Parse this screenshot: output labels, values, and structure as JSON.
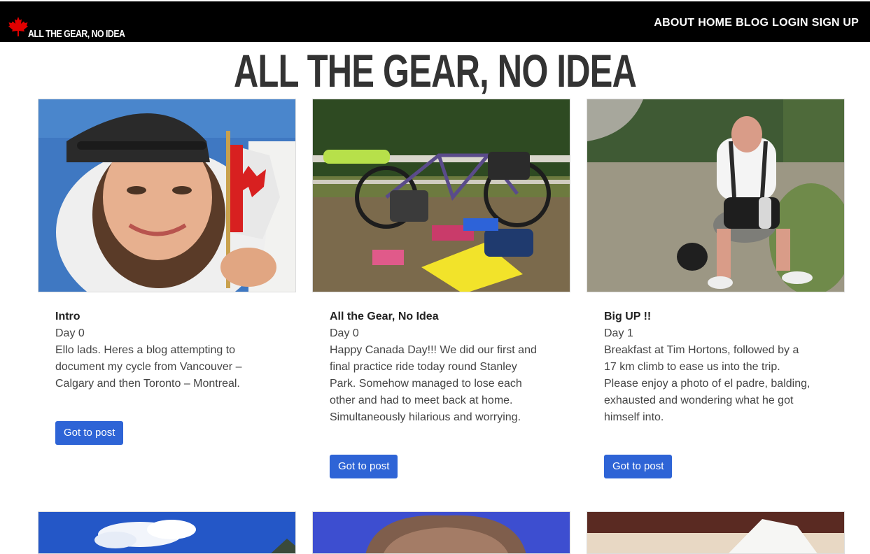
{
  "navbar": {
    "brand_text": "ALL THE GEAR, NO IDEA",
    "links": [
      "ABOUT",
      "HOME",
      "BLOG",
      "LOGIN",
      "SIGN UP"
    ]
  },
  "page": {
    "title": "ALL THE GEAR, NO IDEA"
  },
  "posts": [
    {
      "title": "Intro",
      "day": "Day 0",
      "excerpt": "Ello lads. Heres a blog attempting to document my cycle from Vancouver – Calgary and then Toronto – Montreal.",
      "button_label": "Got to post"
    },
    {
      "title": "All the Gear, No Idea",
      "day": "Day 0",
      "excerpt": "Happy Canada Day!!! We did our first and final practice ride today round Stanley Park. Somehow managed to lose each other and had to meet back at home. Simultaneously hilarious and worrying.",
      "button_label": "Got to post"
    },
    {
      "title": "Big UP !!",
      "day": "Day 1",
      "excerpt": "Breakfast at Tim Hortons, followed by a 17 km climb to ease us into the trip. Please enjoy a photo of el padre, balding, exhausted and wondering what he got himself into.",
      "button_label": "Got to post"
    }
  ],
  "colors": {
    "navbar_bg": "#000000",
    "button_bg": "#2e64d6",
    "maple_leaf": "#e00000"
  }
}
